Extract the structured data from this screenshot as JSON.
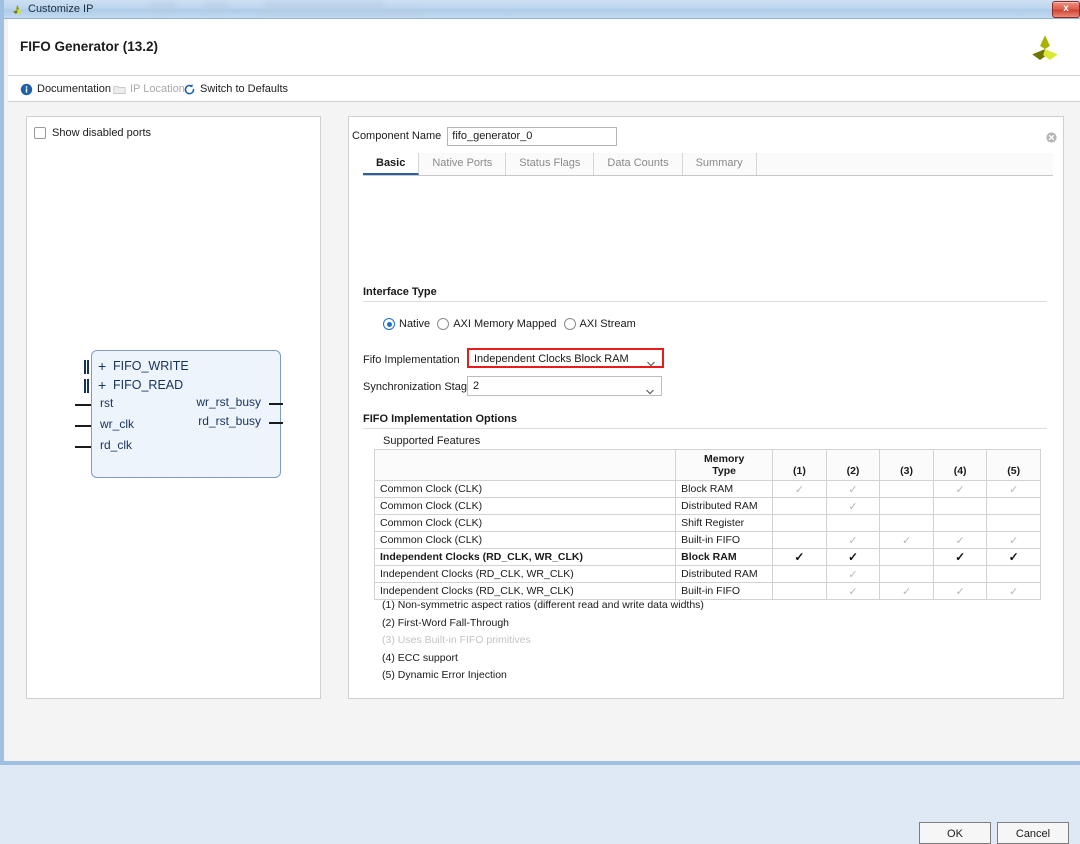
{
  "window": {
    "title": "Customize IP",
    "title_icon": "xilinx-logo-icon",
    "close_label": "x"
  },
  "header": {
    "title": "FIFO Generator (13.2)",
    "logo_icon": "xilinx-logo-icon"
  },
  "toolbar": {
    "items": [
      {
        "label": "Documentation",
        "icon": "info-icon",
        "disabled": false
      },
      {
        "label": "IP Location",
        "icon": "folder-icon",
        "disabled": true
      },
      {
        "label": "Switch to Defaults",
        "icon": "refresh-icon",
        "disabled": false
      }
    ]
  },
  "left_panel": {
    "show_disabled_ports": {
      "label": "Show disabled ports",
      "checked": false
    },
    "diagram": {
      "bus_ports": [
        {
          "label": "FIFO_WRITE",
          "expand_icon": "plus-icon"
        },
        {
          "label": "FIFO_READ",
          "expand_icon": "plus-icon"
        }
      ],
      "input_ports": [
        "rst",
        "wr_clk",
        "rd_clk"
      ],
      "output_ports": [
        "wr_rst_busy",
        "rd_rst_busy"
      ]
    }
  },
  "component_name": {
    "label": "Component Name",
    "value": "fifo_generator_0",
    "placeholder": "",
    "clear_icon": "clear-circle-icon"
  },
  "tabs": [
    {
      "label": "Basic",
      "active": true
    },
    {
      "label": "Native Ports",
      "active": false
    },
    {
      "label": "Status Flags",
      "active": false
    },
    {
      "label": "Data Counts",
      "active": false
    },
    {
      "label": "Summary",
      "active": false
    }
  ],
  "interface_type": {
    "section_title": "Interface Type",
    "options": [
      {
        "label": "Native",
        "checked": true
      },
      {
        "label": "AXI Memory Mapped",
        "checked": false
      },
      {
        "label": "AXI Stream",
        "checked": false
      }
    ]
  },
  "fifo_implementation": {
    "label": "Fifo Implementation",
    "value": "Independent Clocks Block RAM",
    "highlighted": true,
    "chevron_icon": "chevron-down-icon"
  },
  "sync_stages": {
    "label": "Synchronization Stages",
    "value": "2",
    "chevron_icon": "chevron-down-icon"
  },
  "fifo_options": {
    "section_title": "FIFO Implementation Options",
    "supported_features_label": "Supported Features",
    "table": {
      "headers": [
        "",
        "Memory\nType",
        "(1)",
        "(2)",
        "(3)",
        "(4)",
        "(5)"
      ],
      "header_memory_type_line1": "Memory",
      "header_memory_type_line2": "Type",
      "header_cols": [
        "(1)",
        "(2)",
        "(3)",
        "(4)",
        "(5)"
      ],
      "rows": [
        {
          "clock": "Common Clock (CLK)",
          "memory": "Block RAM",
          "marks": [
            "light",
            "light",
            "",
            "light",
            "light"
          ],
          "bold": false
        },
        {
          "clock": "Common Clock (CLK)",
          "memory": "Distributed RAM",
          "marks": [
            "",
            "light",
            "",
            "",
            ""
          ],
          "bold": false
        },
        {
          "clock": "Common Clock (CLK)",
          "memory": "Shift Register",
          "marks": [
            "",
            "",
            "",
            "",
            ""
          ],
          "bold": false
        },
        {
          "clock": "Common Clock (CLK)",
          "memory": "Built-in FIFO",
          "marks": [
            "",
            "light",
            "light",
            "light",
            "light"
          ],
          "bold": false
        },
        {
          "clock": "Independent Clocks (RD_CLK, WR_CLK)",
          "memory": "Block RAM",
          "marks": [
            "dark",
            "dark",
            "",
            "dark",
            "dark"
          ],
          "bold": true
        },
        {
          "clock": "Independent Clocks (RD_CLK, WR_CLK)",
          "memory": "Distributed RAM",
          "marks": [
            "",
            "light",
            "",
            "",
            ""
          ],
          "bold": false
        },
        {
          "clock": "Independent Clocks (RD_CLK, WR_CLK)",
          "memory": "Built-in FIFO",
          "marks": [
            "",
            "light",
            "light",
            "light",
            "light"
          ],
          "bold": false
        }
      ]
    },
    "footnotes": [
      {
        "text": "(1) Non-symmetric aspect ratios (different read and write data widths)",
        "dim": false
      },
      {
        "text": "(2) First-Word Fall-Through",
        "dim": false
      },
      {
        "text": "(3) Uses Built-in FIFO primitives",
        "dim": true
      },
      {
        "text": "(4) ECC support",
        "dim": false
      },
      {
        "text": "(5) Dynamic Error Injection",
        "dim": false
      }
    ]
  },
  "buttons": {
    "ok": "OK",
    "cancel": "Cancel"
  },
  "colors": {
    "accent_blue": "#1c6fd0",
    "highlight_red": "#e81c1c",
    "titlebar_blue": "#bcd6ee",
    "logo_yellow": "#c8d400"
  },
  "glyphs": {
    "check": "✓",
    "plus": "+"
  }
}
